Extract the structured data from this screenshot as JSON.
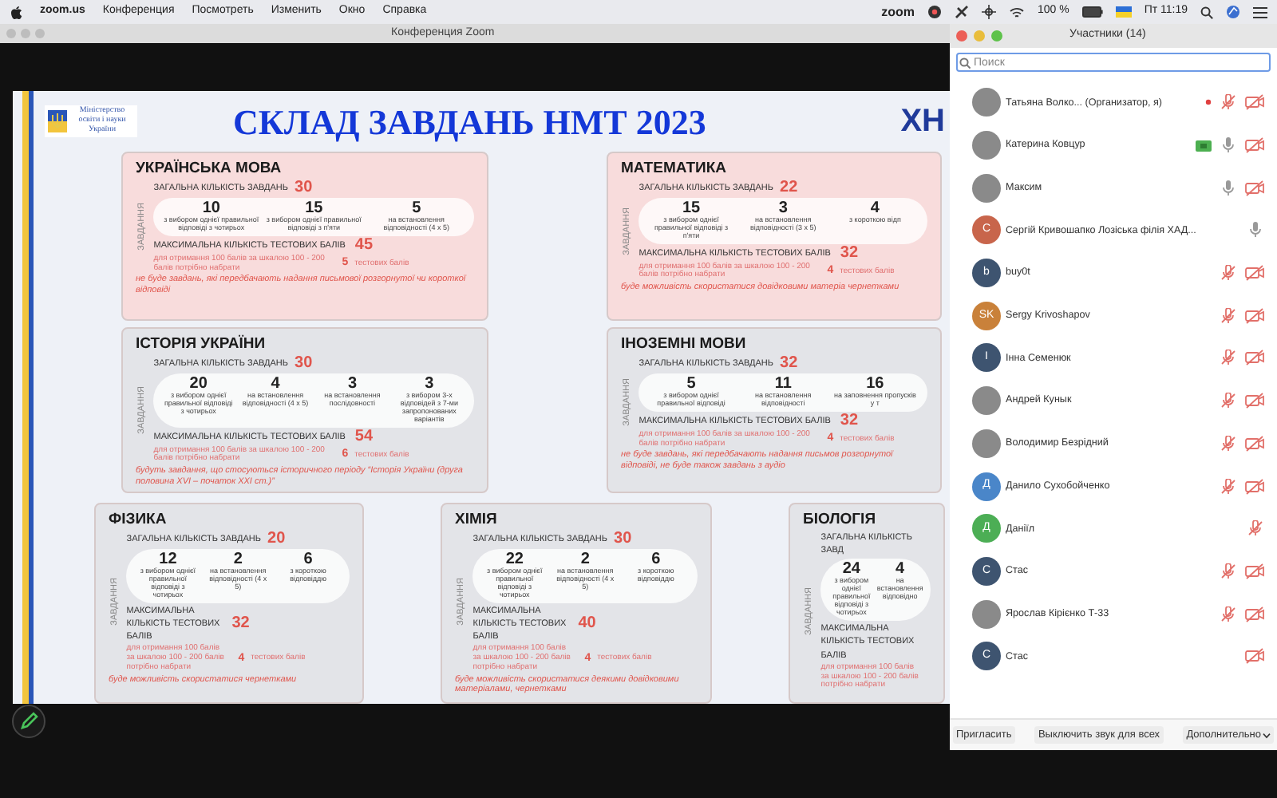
{
  "menu_bar": {
    "app": "zoom.us",
    "items": [
      "Конференция",
      "Посмотреть",
      "Изменить",
      "Окно",
      "Справка"
    ],
    "zoom_label": "zoom",
    "battery": "100 %",
    "clock": "Пт 11:19"
  },
  "window": {
    "title": "Конференция Zoom"
  },
  "slide": {
    "ministry": "Міністерство освіти і науки України",
    "title": "СКЛАД ЗАВДАНЬ НМТ 2023",
    "logo_text": "ХН",
    "rows": [
      [
        {
          "title": "УКРАЇНСЬКА МОВА",
          "color": "#f8dcdc",
          "tasks_label": "ЗАВДАННЯ",
          "total_label": "ЗАГАЛЬНА КІЛЬКІСТЬ ЗАВДАНЬ",
          "total": "30",
          "tasks": [
            {
              "count": "10",
              "caption": "з вибором однієї правильної відповіді з чотирьох"
            },
            {
              "count": "15",
              "caption": "з вибором однієї правильної відповіді з п'яти"
            },
            {
              "count": "5",
              "caption": "на встановлення відповідності (4 х 5)"
            }
          ],
          "max_label": "МАКСИМАЛЬНА КІЛЬКІСТЬ ТЕСТОВИХ БАЛІВ",
          "max": "45",
          "hint": "для отримання 100 балів за шкалою 100 - 200 балів потрібно набрати",
          "needed": "5",
          "needed_unit": "тестових балів",
          "note": "не буде завдань, які передбачають надання письмової розгорнутої чи короткої відповіді"
        },
        {
          "title": "МАТЕМАТИКА",
          "color": "#f8dcdc",
          "tasks_label": "ЗАВДАННЯ",
          "total_label": "ЗАГАЛЬНА КІЛЬКІСТЬ ЗАВДАНЬ",
          "total": "22",
          "tasks": [
            {
              "count": "15",
              "caption": "з вибором однієї правильної відповіді з п'яти"
            },
            {
              "count": "3",
              "caption": "на встановлення відповідності (3 х 5)"
            },
            {
              "count": "4",
              "caption": "з короткою відп"
            }
          ],
          "max_label": "МАКСИМАЛЬНА КІЛЬКІСТЬ ТЕСТОВИХ БАЛІВ",
          "max": "32",
          "hint": "для отримання 100 балів за шкалою 100 - 200 балів потрібно набрати",
          "needed": "4",
          "needed_unit": "тестових балів",
          "note": "буде можливість скористатися довідковими матеріа чернетками"
        }
      ],
      [
        {
          "title": "ІСТОРІЯ УКРАЇНИ",
          "color": "#e3e4e8",
          "tasks_label": "ЗАВДАННЯ",
          "total_label": "ЗАГАЛЬНА КІЛЬКІСТЬ ЗАВДАНЬ",
          "total": "30",
          "tasks": [
            {
              "count": "20",
              "caption": "з вибором однієї правильної відповіді з чотирьох"
            },
            {
              "count": "4",
              "caption": "на встановлення відповідності (4 х 5)"
            },
            {
              "count": "3",
              "caption": "на встановлення послідовності"
            },
            {
              "count": "3",
              "caption": "з вибором 3-х відповідей з 7-ми запропонованих варіантів"
            }
          ],
          "max_label": "МАКСИМАЛЬНА КІЛЬКІСТЬ ТЕСТОВИХ БАЛІВ",
          "max": "54",
          "hint": "для отримання 100 балів за шкалою 100 - 200 балів потрібно набрати",
          "needed": "6",
          "needed_unit": "тестових балів",
          "note": "будуть завдання, що стосуються історичного періоду “Історія України (друга половина XVI – початок XXI ст.)”"
        },
        {
          "title": "ІНОЗЕМНІ МОВИ",
          "color": "#e3e4e8",
          "tasks_label": "ЗАВДАННЯ",
          "total_label": "ЗАГАЛЬНА КІЛЬКІСТЬ ЗАВДАНЬ",
          "total": "32",
          "tasks": [
            {
              "count": "5",
              "caption": "з вибором однієї правильної відповіді"
            },
            {
              "count": "11",
              "caption": "на встановлення відповідності"
            },
            {
              "count": "16",
              "caption": "на заповнення пропусків у т"
            }
          ],
          "max_label": "МАКСИМАЛЬНА КІЛЬКІСТЬ ТЕСТОВИХ БАЛІВ",
          "max": "32",
          "hint": "для отримання 100 балів за шкалою 100 - 200 балів потрібно набрати",
          "needed": "4",
          "needed_unit": "тестових балів",
          "note": "не буде завдань, які передбачають надання письмов розгорнутої відповіді, не буде також завдань з аудіо"
        }
      ],
      [
        {
          "title": "ФІЗИКА",
          "color": "#e3e4e8",
          "tasks_label": "ЗАВДАННЯ",
          "total_label": "ЗАГАЛЬНА КІЛЬКІСТЬ ЗАВДАНЬ",
          "total": "20",
          "tasks": [
            {
              "count": "12",
              "caption": "з вибором однієї правильної відповіді з чотирьох"
            },
            {
              "count": "2",
              "caption": "на встановлення відповідності (4 х 5)"
            },
            {
              "count": "6",
              "caption": "з короткою відповіддю"
            }
          ],
          "max_label": "МАКСИМАЛЬНА КІЛЬКІСТЬ ТЕСТОВИХ БАЛІВ",
          "max": "32",
          "hint": "для отримання 100 балів за шкалою 100 - 200 балів потрібно набрати",
          "needed": "4",
          "needed_unit": "тестових балів",
          "note": "буде можливість скористатися чернетками"
        },
        {
          "title": "ХІМІЯ",
          "color": "#e3e4e8",
          "tasks_label": "ЗАВДАННЯ",
          "total_label": "ЗАГАЛЬНА КІЛЬКІСТЬ ЗАВДАНЬ",
          "total": "30",
          "tasks": [
            {
              "count": "22",
              "caption": "з вибором однієї правильної відповіді з чотирьох"
            },
            {
              "count": "2",
              "caption": "на встановлення відповідності (4 х 5)"
            },
            {
              "count": "6",
              "caption": "з короткою відповіддю"
            }
          ],
          "max_label": "МАКСИМАЛЬНА КІЛЬКІСТЬ ТЕСТОВИХ БАЛІВ",
          "max": "40",
          "hint": "для отримання 100 балів за шкалою 100 - 200 балів потрібно набрати",
          "needed": "4",
          "needed_unit": "тестових балів",
          "note": "буде можливість скористатися деякими довідковими матеріалами, чернетками"
        },
        {
          "title": "БІОЛОГІЯ",
          "color": "#e3e4e8",
          "tasks_label": "ЗАВДАННЯ",
          "total_label": "ЗАГАЛЬНА КІЛЬКІСТЬ ЗАВД",
          "tasks": [
            {
              "count": "24",
              "caption": "з вибором однієї правильної відповіді з чотирьох"
            },
            {
              "count": "4",
              "caption": "на встановлення відповідно"
            }
          ],
          "max_label": "МАКСИМАЛЬНА КІЛЬКІСТЬ ТЕСТОВИХ БАЛІВ",
          "hint": "для отримання 100 балів за шкалою 100 - 200 балів потрібно набрати"
        }
      ]
    ]
  },
  "participants_panel": {
    "title": "Участники (14)",
    "search": {
      "placeholder": "Поиск"
    },
    "participants": [
      {
        "name": "Татьяна Волко... (Организатор, я)",
        "avatar": {
          "kind": "photo"
        },
        "recording": true,
        "sharing": false,
        "mic": {
          "muted": true
        },
        "video_off": true
      },
      {
        "name": "Катерина Ковцур",
        "avatar": {
          "kind": "photo"
        },
        "recording": false,
        "sharing": true,
        "mic": {
          "muted": false
        },
        "video_off": true
      },
      {
        "name": "Максим",
        "avatar": {
          "kind": "photo"
        },
        "recording": false,
        "sharing": false,
        "mic": {
          "muted": false
        },
        "video_off": true
      },
      {
        "name": "Сергій Кривошапко Лозіська філія ХАД...",
        "avatar": {
          "kind": "initials",
          "text": "С",
          "color": "#c8654b"
        },
        "recording": false,
        "sharing": false,
        "mic": {
          "muted": false
        },
        "video_off": false
      },
      {
        "name": "buy0t",
        "avatar": {
          "kind": "initials",
          "text": "b",
          "color": "#3e5470"
        },
        "recording": false,
        "sharing": false,
        "mic": {
          "muted": true
        },
        "video_off": true
      },
      {
        "name": "Sergy Krivoshapov",
        "avatar": {
          "kind": "initials",
          "text": "SK",
          "color": "#c9813a"
        },
        "recording": false,
        "sharing": false,
        "mic": {
          "muted": true
        },
        "video_off": true
      },
      {
        "name": "Інна Семенюк",
        "avatar": {
          "kind": "initials",
          "text": "І",
          "color": "#3e5470"
        },
        "recording": false,
        "sharing": false,
        "mic": {
          "muted": true
        },
        "video_off": true
      },
      {
        "name": "Андрей Кунык",
        "avatar": {
          "kind": "photo"
        },
        "recording": false,
        "sharing": false,
        "mic": {
          "muted": true
        },
        "video_off": true
      },
      {
        "name": "Володимир Безрідний",
        "avatar": {
          "kind": "photo"
        },
        "recording": false,
        "sharing": false,
        "mic": {
          "muted": true
        },
        "video_off": true
      },
      {
        "name": "Данило Сухобойченко",
        "avatar": {
          "kind": "initials",
          "text": "Д",
          "color": "#4a86c9"
        },
        "recording": false,
        "sharing": false,
        "mic": {
          "muted": true
        },
        "video_off": true
      },
      {
        "name": "Даніїл",
        "avatar": {
          "kind": "initials",
          "text": "Д",
          "color": "#4cae55"
        },
        "recording": false,
        "sharing": false,
        "mic": {
          "muted": true
        },
        "video_off": false
      },
      {
        "name": "Стас",
        "avatar": {
          "kind": "initials",
          "text": "С",
          "color": "#3e5470"
        },
        "recording": false,
        "sharing": false,
        "mic": {
          "muted": true
        },
        "video_off": true
      },
      {
        "name": "Ярослав Кірієнко Т-33",
        "avatar": {
          "kind": "photo"
        },
        "recording": false,
        "sharing": false,
        "mic": {
          "muted": true
        },
        "video_off": true
      },
      {
        "name": "Стас",
        "avatar": {
          "kind": "initials",
          "text": "С",
          "color": "#3e5470"
        },
        "recording": false,
        "sharing": false,
        "video_off": true
      }
    ],
    "buttons": [
      "Пригласить",
      "Выключить звук для всех",
      "Дополнительно"
    ]
  }
}
